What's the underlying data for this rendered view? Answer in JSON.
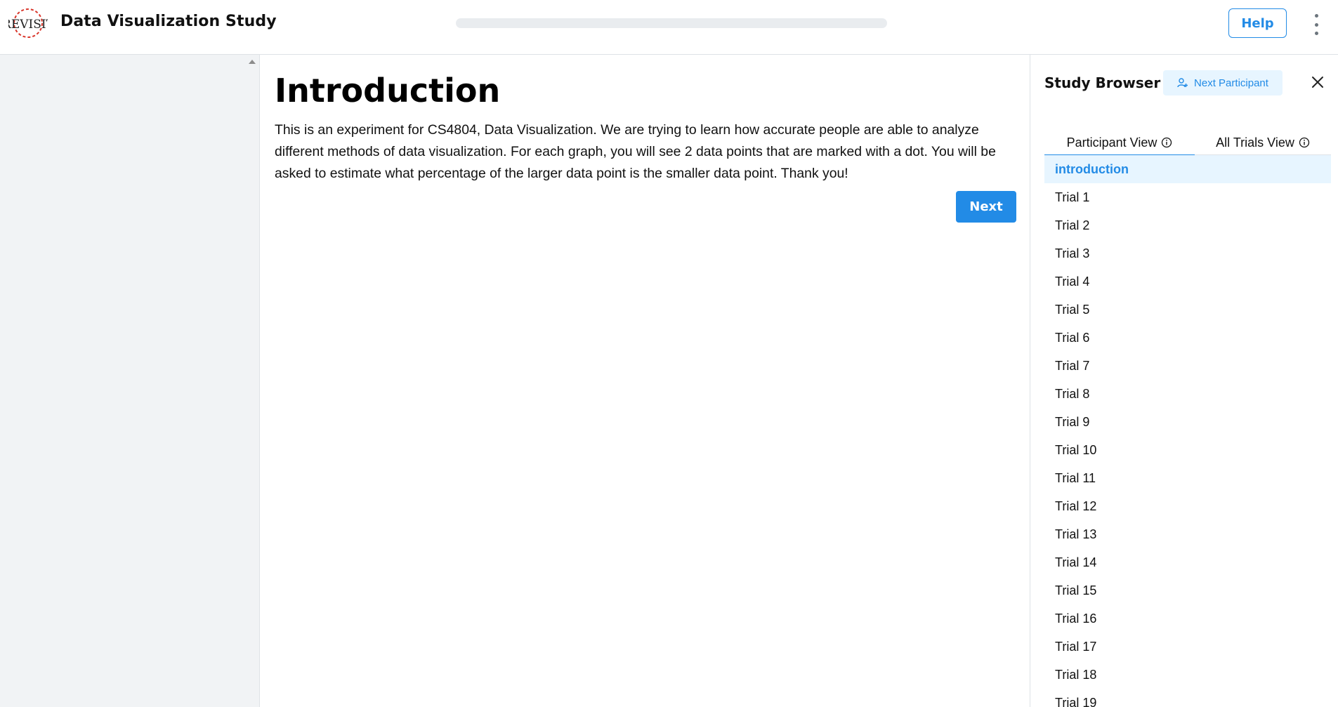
{
  "header": {
    "logo_text": "REVISIT",
    "title": "Data Visualization Study",
    "progress": 0,
    "help_label": "Help"
  },
  "main": {
    "heading": "Introduction",
    "body": "This is an experiment for CS4804, Data Visualization. We are trying to learn how accurate people are able to analyze different methods of data visualization. For each graph, you will see 2 data points that are marked with a dot. You will be asked to estimate what percentage of the larger data point is the smaller data point. Thank you!",
    "next_label": "Next"
  },
  "sidebar": {
    "title": "Study Browser",
    "next_participant_label": "Next Participant",
    "tabs": [
      {
        "label": "Participant View",
        "active": true
      },
      {
        "label": "All Trials View",
        "active": false
      }
    ],
    "items": [
      {
        "label": "introduction",
        "active": true
      },
      {
        "label": "Trial 1"
      },
      {
        "label": "Trial 2"
      },
      {
        "label": "Trial 3"
      },
      {
        "label": "Trial 4"
      },
      {
        "label": "Trial 5"
      },
      {
        "label": "Trial 6"
      },
      {
        "label": "Trial 7"
      },
      {
        "label": "Trial 8"
      },
      {
        "label": "Trial 9"
      },
      {
        "label": "Trial 10"
      },
      {
        "label": "Trial 11"
      },
      {
        "label": "Trial 12"
      },
      {
        "label": "Trial 13"
      },
      {
        "label": "Trial 14"
      },
      {
        "label": "Trial 15"
      },
      {
        "label": "Trial 16"
      },
      {
        "label": "Trial 17"
      },
      {
        "label": "Trial 18"
      },
      {
        "label": "Trial 19"
      }
    ]
  },
  "colors": {
    "accent": "#228be6",
    "accent_light": "#e7f5ff",
    "logo_red": "#d9362b"
  },
  "icons": [
    "revisit-logo",
    "kebab-menu-icon",
    "add-user-icon",
    "close-icon",
    "info-icon",
    "scroll-up-arrow-icon"
  ]
}
